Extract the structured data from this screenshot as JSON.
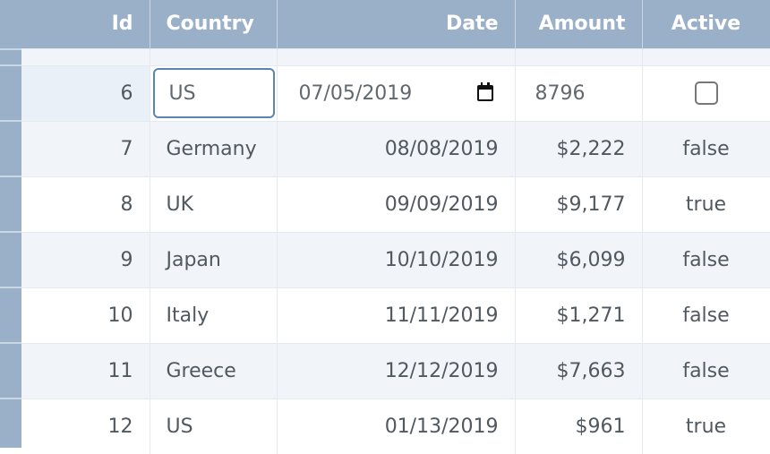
{
  "columns": [
    {
      "key": "id",
      "label": "Id"
    },
    {
      "key": "country",
      "label": "Country"
    },
    {
      "key": "date",
      "label": "Date"
    },
    {
      "key": "amount",
      "label": "Amount"
    },
    {
      "key": "active",
      "label": "Active"
    }
  ],
  "edit_row": {
    "id": "6",
    "country": "US",
    "date": "07/05/2019",
    "amount": "8796",
    "active": false,
    "icons": {
      "date_picker": "calendar-icon"
    }
  },
  "rows": [
    {
      "id": "7",
      "country": "Germany",
      "date": "08/08/2019",
      "amount": "$2,222",
      "active": "false"
    },
    {
      "id": "8",
      "country": "UK",
      "date": "09/09/2019",
      "amount": "$9,177",
      "active": "true"
    },
    {
      "id": "9",
      "country": "Japan",
      "date": "10/10/2019",
      "amount": "$6,099",
      "active": "false"
    },
    {
      "id": "10",
      "country": "Italy",
      "date": "11/11/2019",
      "amount": "$1,271",
      "active": "false"
    },
    {
      "id": "11",
      "country": "Greece",
      "date": "12/12/2019",
      "amount": "$7,663",
      "active": "false"
    },
    {
      "id": "12",
      "country": "US",
      "date": "01/13/2019",
      "amount": "$961",
      "active": "true"
    }
  ]
}
